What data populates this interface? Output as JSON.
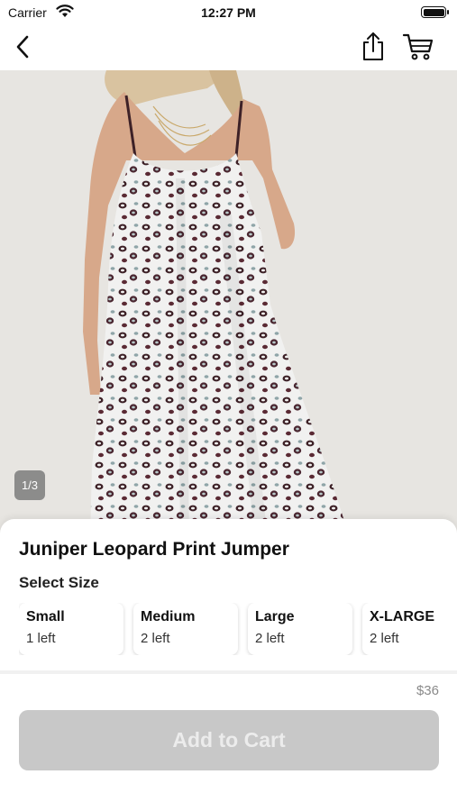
{
  "status_bar": {
    "carrier": "Carrier",
    "time": "12:27 PM",
    "wifi_icon": "wifi-icon",
    "battery_icon": "battery-icon"
  },
  "nav": {
    "back_icon": "chevron-left-icon",
    "share_icon": "share-icon",
    "cart_icon": "cart-icon"
  },
  "gallery": {
    "page_indicator": "1/3",
    "image": "leopard-print-jumper-photo",
    "background": "#e7e5e1"
  },
  "product": {
    "title": "Juniper Leopard Print Jumper",
    "select_size_label": "Select Size",
    "sizes": [
      {
        "name": "Small",
        "stock": "1 left"
      },
      {
        "name": "Medium",
        "stock": "2 left"
      },
      {
        "name": "Large",
        "stock": "2 left"
      },
      {
        "name": "X-LARGE",
        "stock": "2 left"
      }
    ],
    "price": "$36"
  },
  "cart_button": {
    "label": "Add to Cart",
    "disabled": true,
    "color": "#c8c8c8"
  }
}
